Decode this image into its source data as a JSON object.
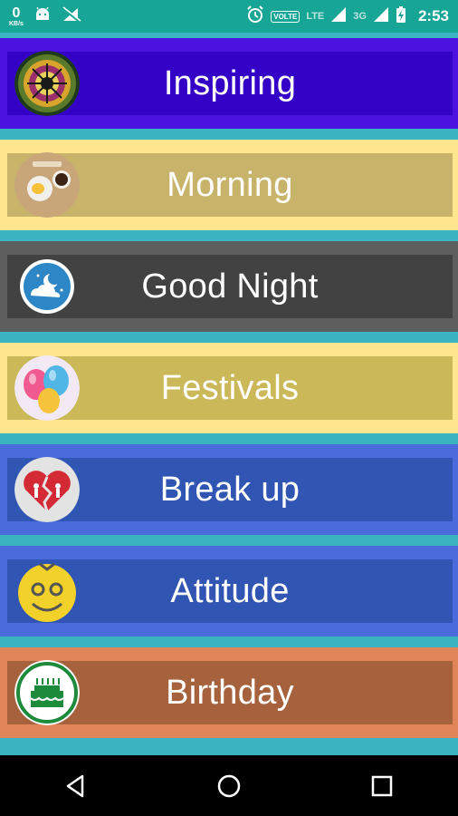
{
  "status_bar": {
    "speed_value": "0",
    "speed_unit": "KB/s",
    "volte": "VOLTE",
    "network_lte": "LTE",
    "network_3g": "3G",
    "time": "2:53"
  },
  "categories": [
    {
      "label": "Inspiring",
      "icon": "mandala-icon",
      "frame_color": "#4b12e0",
      "bar_color": "#3402c6"
    },
    {
      "label": "Morning",
      "icon": "coffee-breakfast-icon",
      "frame_color": "#fde68e",
      "bar_color": "#c7b36a"
    },
    {
      "label": "Good Night",
      "icon": "moon-cloud-icon",
      "frame_color": "#5e5e5e",
      "bar_color": "#424242"
    },
    {
      "label": "Festivals",
      "icon": "balloons-icon",
      "frame_color": "#fde68e",
      "bar_color": "#cbb858"
    },
    {
      "label": "Break up",
      "icon": "broken-heart-icon",
      "frame_color": "#4b6bdc",
      "bar_color": "#3155b3"
    },
    {
      "label": "Attitude",
      "icon": "smiley-face-icon",
      "frame_color": "#4b6bdc",
      "bar_color": "#3155b3"
    },
    {
      "label": "Birthday",
      "icon": "birthday-cake-icon",
      "frame_color": "#e0855a",
      "bar_color": "#a6623c"
    }
  ],
  "nav": {
    "back": "back-icon",
    "home": "home-icon",
    "recents": "recents-icon"
  }
}
